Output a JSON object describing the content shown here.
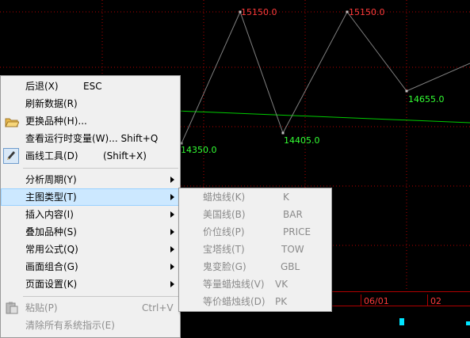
{
  "chart": {
    "grid_color": "#b00000",
    "line_color": "#808080",
    "trend_color": "#00cc00",
    "points": [
      {
        "label": "14350.0",
        "color": "red"
      },
      {
        "label": "15150.0",
        "color": "red"
      },
      {
        "label": "14405.0",
        "color": "green"
      },
      {
        "label": "15150.0",
        "color": "red"
      },
      {
        "label": "14655.0",
        "color": "green"
      }
    ],
    "date_labels": [
      "06/01",
      "02"
    ]
  },
  "menu": {
    "items": [
      {
        "label": "后退(X)",
        "shortcut": "ESC"
      },
      {
        "label": "刷新数据(R)",
        "shortcut": ""
      },
      {
        "label": "更换品种(H)...",
        "shortcut": "",
        "icon": "folder-icon"
      },
      {
        "label": "查看运行时变量(W)... Shift+Q",
        "shortcut": ""
      },
      {
        "label": "画线工具(D)",
        "shortcut": "(Shift+X)",
        "icon": "pen-icon"
      },
      {
        "label": "分析周期(Y)",
        "submenu": true
      },
      {
        "label": "主图类型(T)",
        "submenu": true,
        "highlighted": true
      },
      {
        "label": "插入内容(I)",
        "submenu": true
      },
      {
        "label": "叠加品种(S)",
        "submenu": true
      },
      {
        "label": "常用公式(Q)",
        "submenu": true
      },
      {
        "label": "画面组合(G)",
        "submenu": true
      },
      {
        "label": "页面设置(K)",
        "submenu": true
      },
      {
        "label": "粘贴(P)",
        "shortcut": "Ctrl+V",
        "disabled": true,
        "icon": "paste-icon"
      },
      {
        "label": "清除所有系统指示(E)",
        "shortcut": "",
        "disabled": true
      }
    ]
  },
  "submenu": {
    "items": [
      {
        "label": "蜡烛线(K)",
        "code": "K"
      },
      {
        "label": "美国线(B)",
        "code": "BAR"
      },
      {
        "label": "价位线(P)",
        "code": "PRICE"
      },
      {
        "label": "宝塔线(T)",
        "code": "TOW"
      },
      {
        "label": "鬼变脸(G)",
        "code": "GBL"
      },
      {
        "label": "等量蜡烛线(V)",
        "code": "VK"
      },
      {
        "label": "等价蜡烛线(D)",
        "code": "PK"
      }
    ]
  }
}
